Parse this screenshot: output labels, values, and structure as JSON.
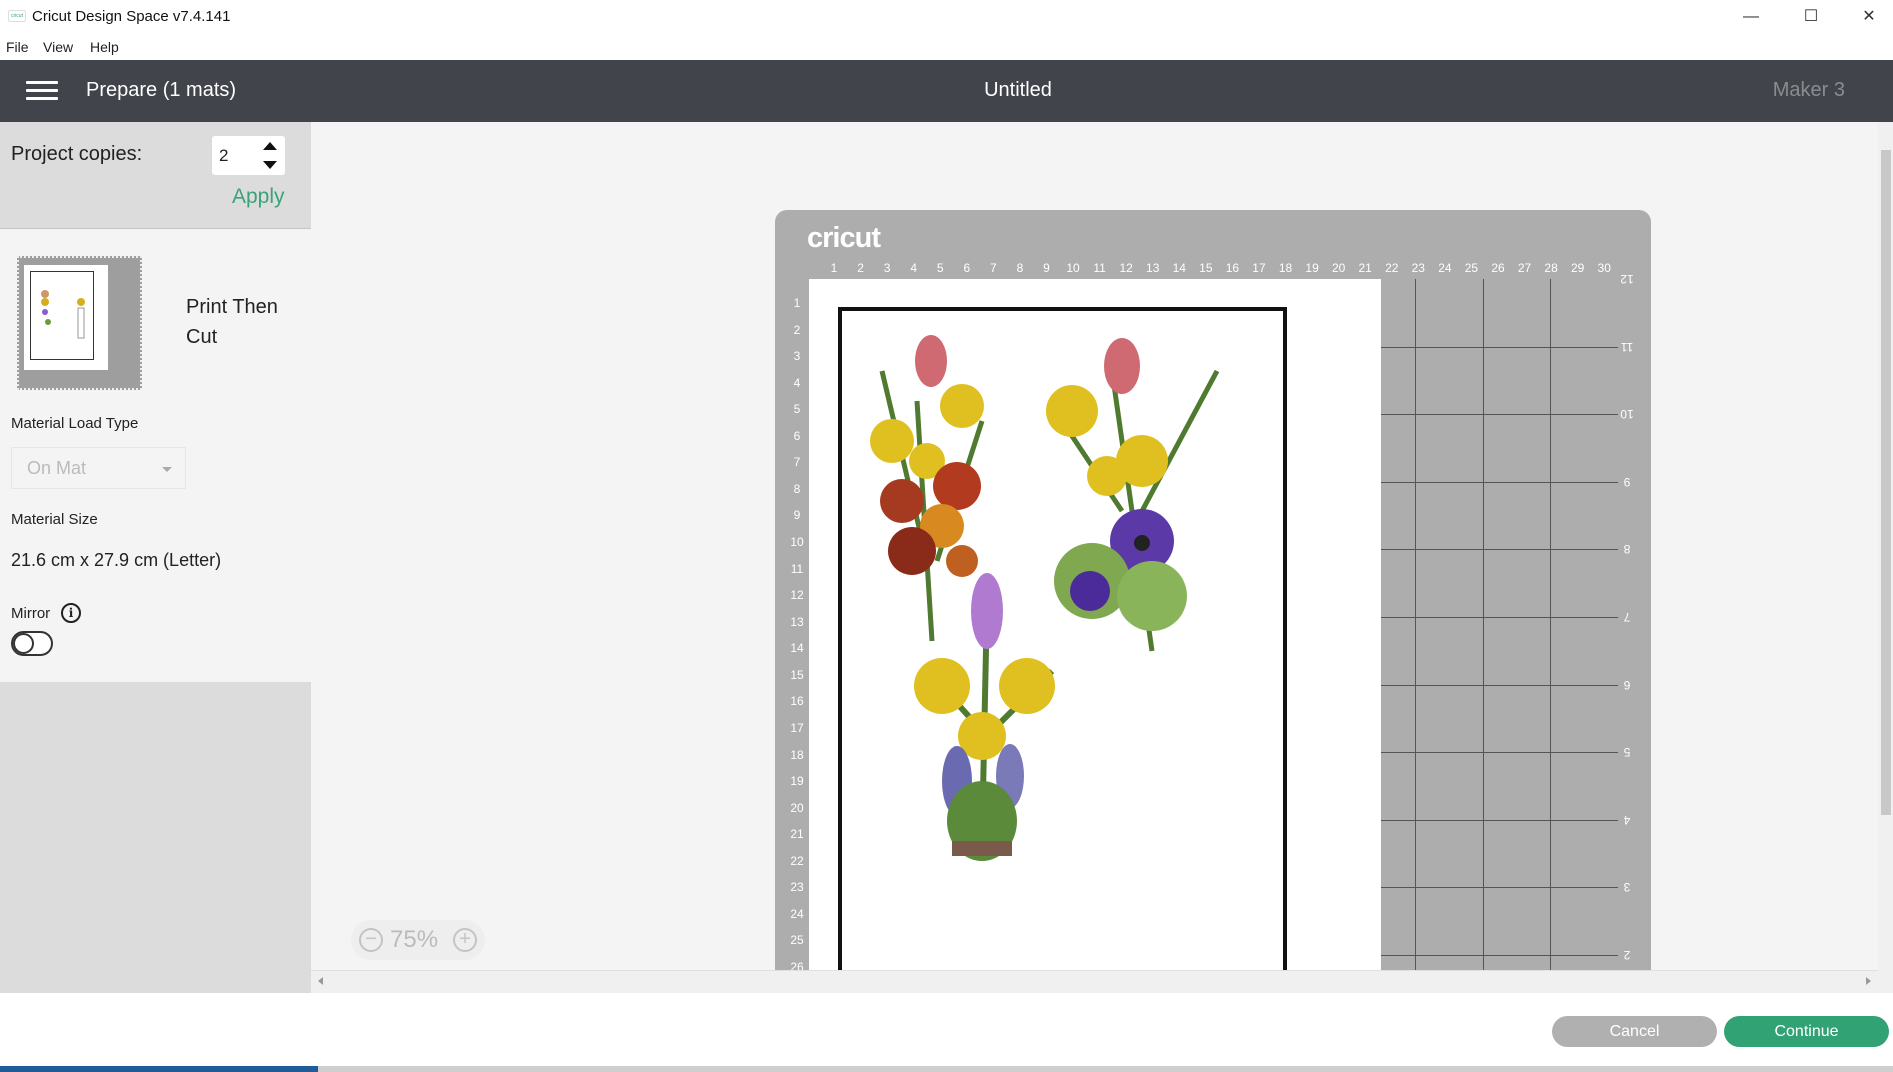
{
  "window": {
    "title": "Cricut Design Space  v7.4.141",
    "icon": "cricut-app-icon",
    "controls": [
      "minimize",
      "maximize",
      "close"
    ]
  },
  "menu": [
    "File",
    "View",
    "Help"
  ],
  "header": {
    "title": "Prepare (1 mats)",
    "document": "Untitled",
    "machine": "Maker 3"
  },
  "left_panel": {
    "copies_label": "Project copies:",
    "copies_value": "2",
    "apply_label": "Apply",
    "mat_mode": "Print Then Cut",
    "load_type_label": "Material Load Type",
    "load_type_value": "On Mat",
    "size_label": "Material Size",
    "size_value": "21.6 cm x 27.9 cm (Letter)",
    "mirror_label": "Mirror",
    "mirror_on": false
  },
  "mat": {
    "brand": "cricut",
    "top_ruler": [
      "1",
      "2",
      "3",
      "4",
      "5",
      "6",
      "7",
      "8",
      "9",
      "10",
      "11",
      "12",
      "13",
      "14",
      "15",
      "16",
      "17",
      "18",
      "19",
      "20",
      "21",
      "22",
      "23",
      "24",
      "25",
      "26",
      "27",
      "28",
      "29",
      "30"
    ],
    "left_ruler": [
      "1",
      "2",
      "3",
      "4",
      "5",
      "6",
      "7",
      "8",
      "9",
      "10",
      "11",
      "12",
      "13",
      "14",
      "15",
      "16",
      "17",
      "18",
      "19",
      "20",
      "21",
      "22",
      "23",
      "24",
      "25",
      "26"
    ],
    "right_ruler": [
      "12",
      "11",
      "10",
      "9",
      "8",
      "7",
      "6",
      "5",
      "4",
      "3",
      "2"
    ]
  },
  "zoom": {
    "value": "75%"
  },
  "footer": {
    "cancel": "Cancel",
    "continue": "Continue"
  },
  "colors": {
    "accent": "#30a273",
    "header": "#41444a",
    "mat": "#adadad"
  }
}
